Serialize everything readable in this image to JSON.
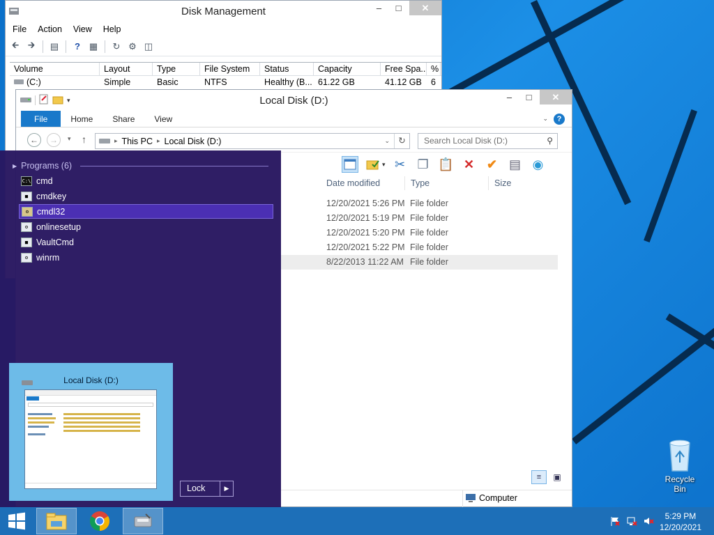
{
  "disk_management": {
    "title": "Disk Management",
    "menu": [
      "File",
      "Action",
      "View",
      "Help"
    ],
    "columns": [
      "Volume",
      "Layout",
      "Type",
      "File System",
      "Status",
      "Capacity",
      "Free Spa...",
      "%"
    ],
    "row": [
      "(C:)",
      "Simple",
      "Basic",
      "NTFS",
      "Healthy (B...",
      "61.22 GB",
      "41.12 GB",
      "6"
    ]
  },
  "explorer": {
    "title": "Local Disk (D:)",
    "tabs": [
      "File",
      "Home",
      "Share",
      "View"
    ],
    "breadcrumb": [
      "This PC",
      "Local Disk (D:)"
    ],
    "search_placeholder": "Search Local Disk (D:)",
    "columns": [
      "Date modified",
      "Type",
      "Size"
    ],
    "rows": [
      {
        "date": "12/20/2021 5:26 PM",
        "type": "File folder"
      },
      {
        "date": "12/20/2021 5:19 PM",
        "type": "File folder"
      },
      {
        "date": "12/20/2021 5:20 PM",
        "type": "File folder"
      },
      {
        "date": "12/20/2021 5:22 PM",
        "type": "File folder"
      },
      {
        "date": "8/22/2013 11:22 AM",
        "type": "File folder"
      }
    ],
    "status_location": "Computer"
  },
  "start_menu": {
    "programs_header": "Programs (6)",
    "programs": [
      "cmd",
      "cmdkey",
      "cmdl32",
      "onlinesetup",
      "VaultCmd",
      "winrm"
    ],
    "selected_index": 2,
    "thumbnail_title": "Local Disk (D:)",
    "lock_label": "Lock"
  },
  "desktop": {
    "recycle_bin_label": "Recycle Bin"
  },
  "taskbar": {
    "time": "5:29 PM",
    "date": "12/20/2021"
  }
}
